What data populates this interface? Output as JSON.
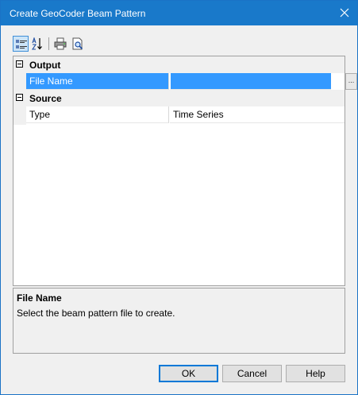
{
  "window": {
    "title": "Create GeoCoder Beam Pattern"
  },
  "toolbar": {
    "items": [
      {
        "icon": "categorized-icon",
        "active": true
      },
      {
        "icon": "alphabetical-sort-icon",
        "active": false
      },
      {
        "icon": "print-icon",
        "active": false
      },
      {
        "icon": "print-preview-icon",
        "active": false
      }
    ]
  },
  "grid": {
    "categories": [
      {
        "label": "Output",
        "expanded": true,
        "properties": [
          {
            "name": "File Name",
            "value": "",
            "selected": true,
            "has_ellipsis": true,
            "ellipsis_label": "..."
          }
        ]
      },
      {
        "label": "Source",
        "expanded": true,
        "properties": [
          {
            "name": "Type",
            "value": "Time Series",
            "selected": false
          }
        ]
      }
    ]
  },
  "description": {
    "title": "File Name",
    "text": "Select the beam pattern file to create."
  },
  "buttons": {
    "ok": "OK",
    "cancel": "Cancel",
    "help": "Help"
  },
  "colors": {
    "title_bar": "#1979ca",
    "selection": "#3399ff",
    "default_button_border": "#0078d7"
  }
}
